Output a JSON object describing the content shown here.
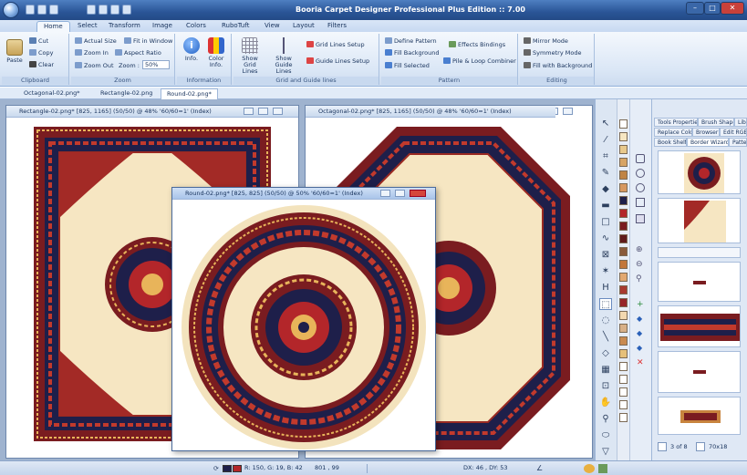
{
  "app": {
    "title": "Booria Carpet Designer Professional Plus Edition :: 7.00"
  },
  "ribbon": {
    "tabs": [
      "Home",
      "Select",
      "Transform",
      "Image",
      "Colors",
      "RuboTuft",
      "View",
      "Layout",
      "Filters"
    ],
    "clipboard": {
      "paste": "Paste",
      "cut": "Cut",
      "copy": "Copy",
      "clear": "Clear",
      "label": "Clipboard"
    },
    "zoom": {
      "actual_size": "Actual Size",
      "fit_in_window": "Fit in Window",
      "zoom_in": "Zoom In",
      "aspect_ratio": "Aspect Ratio",
      "zoom_out": "Zoom Out",
      "zoom_label_text": "Zoom :",
      "zoom_value": "50%",
      "label": "Zoom"
    },
    "information": {
      "info": "Info.",
      "color_info": "Color Info.",
      "label": "Information"
    },
    "grid": {
      "show_grid_lines": "Show Grid Lines",
      "show_guide_lines": "Show Guide Lines",
      "grid_lines_setup": "Grid Lines Setup",
      "guide_lines_setup": "Guide Lines Setup",
      "label": "Grid and Guide lines"
    },
    "pattern": {
      "define_pattern": "Define Pattern",
      "fill_background": "Fill Background",
      "fill_selected": "Fill Selected",
      "effects_bindings": "Effects Bindings",
      "pile_loop": "Pile & Loop Combiner",
      "label": "Pattern"
    },
    "editing": {
      "mirror_mode": "Mirror Mode",
      "symmetry_mode": "Symmetry Mode",
      "fill_with_background": "Fill with Background",
      "label": "Editing"
    }
  },
  "doc_tabs": [
    "Octagonal-02.png*",
    "Rectangle-02.png",
    "Round-02.png*"
  ],
  "windows": {
    "rect": {
      "title": "Rectangle-02.png* [825, 1165] (50/50) @ 48% '60/60=1' (Index)"
    },
    "octa": {
      "title": "Octagonal-02.png* [825, 1165] (50/50) @ 48% '60/60=1' (Index)"
    },
    "round": {
      "title": "Round-02.png* [825, 825] (50/50) @ 50% '60/60=1' (Index)"
    }
  },
  "panel": {
    "tabs_row1": [
      "Tools Properties",
      "Brush Shape",
      "Librar"
    ],
    "tabs_row2": [
      "Replace Colors",
      "Browser",
      "Edit RGB"
    ],
    "tabs_row3": [
      "Book Shelf",
      "Border Wizard",
      "Pattern"
    ],
    "page": "3 of 8",
    "size": "70x18"
  },
  "status": {
    "color": "R: 150, G: 19, B: 42",
    "coords": "801 , 99",
    "delta": "DX: 46 , DY: 53"
  },
  "colors": {
    "ground": "#f6e6c2",
    "maroon": "#7a1c20",
    "navy": "#1e1f4a",
    "red": "#b3262a"
  }
}
